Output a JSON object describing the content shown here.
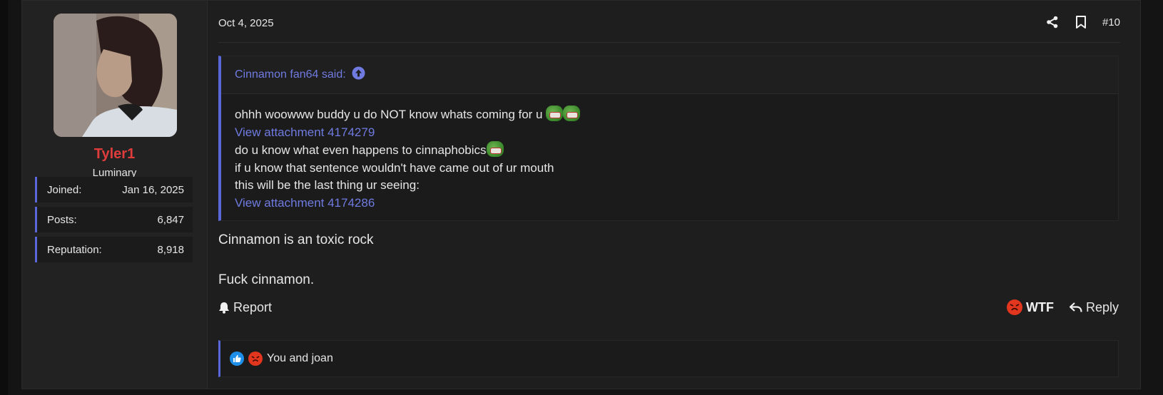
{
  "user": {
    "name": "Tyler1",
    "title": "Luminary",
    "stats": [
      {
        "label": "Joined:",
        "value": "Jan 16, 2025"
      },
      {
        "label": "Posts:",
        "value": "6,847"
      },
      {
        "label": "Reputation:",
        "value": "8,918"
      }
    ],
    "name_color": "#e03c3c"
  },
  "post": {
    "date": "Oct 4, 2025",
    "number": "#10",
    "icons": [
      "share-icon",
      "bookmark-icon"
    ],
    "quote": {
      "author_line": "Cinnamon fan64 said:",
      "lines": [
        "ohhh woowww buddy u do NOT know whats coming for u",
        "View attachment 4174279",
        "do u know what even happens to cinnaphobics",
        "if u know that sentence wouldn't have came out of ur mouth",
        "this will be the last thing ur seeing:",
        "View attachment 4174286"
      ]
    },
    "body": [
      "Cinnamon is an toxic rock",
      "Fuck cinnamon."
    ],
    "actions": {
      "report": "Report",
      "reaction": "WTF",
      "reply": "Reply"
    },
    "reactions": {
      "text": "You and joan",
      "icons": [
        "thumbs-up-icon",
        "angry-face-icon"
      ]
    }
  },
  "colors": {
    "accent": "#5a67d8",
    "link": "#6f7be0",
    "background": "#1e1e1e"
  }
}
